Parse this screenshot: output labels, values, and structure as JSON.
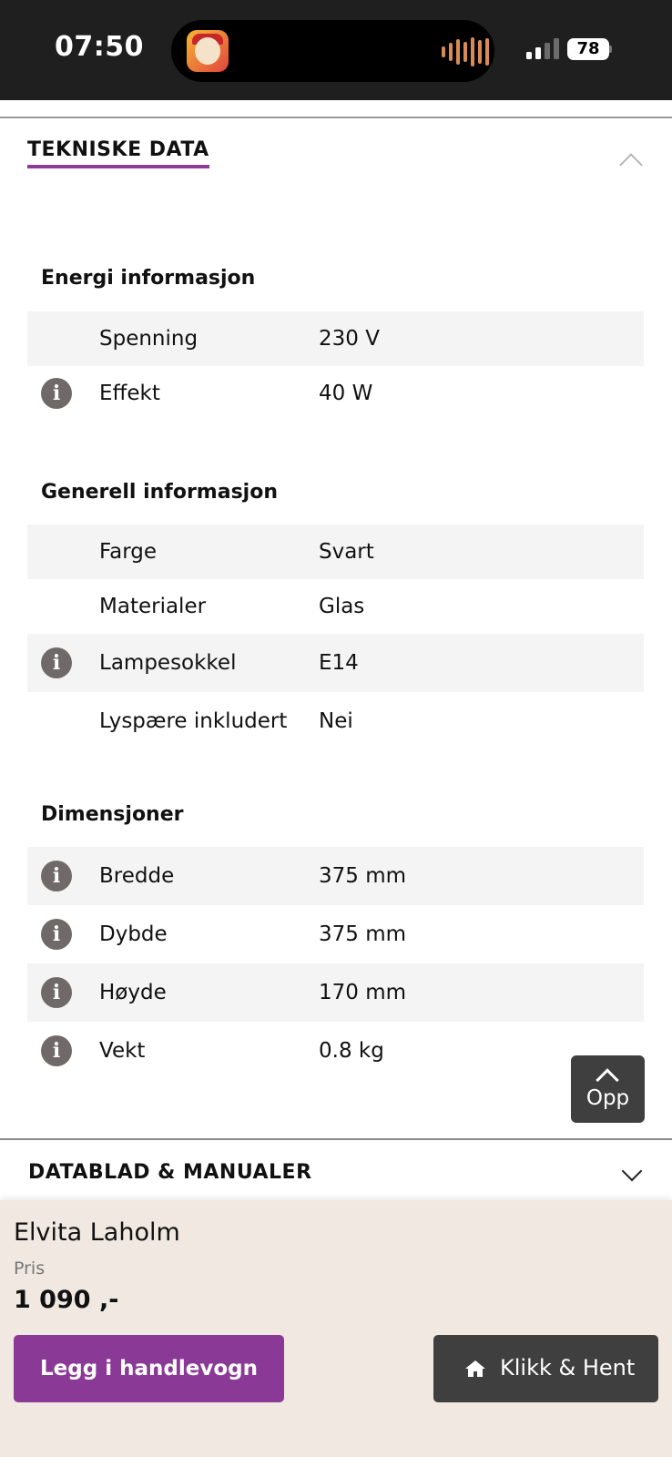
{
  "status_bar": {
    "time": "07:50",
    "battery": "78"
  },
  "section": {
    "title": "TEKNISKE DATA"
  },
  "groups": [
    {
      "title": "Energi informasjon",
      "rows": [
        {
          "label": "Spenning",
          "value": "230 V",
          "info": false
        },
        {
          "label": "Effekt",
          "value": "40 W",
          "info": true
        }
      ]
    },
    {
      "title": "Generell informasjon",
      "rows": [
        {
          "label": "Farge",
          "value": "Svart",
          "info": false
        },
        {
          "label": "Materialer",
          "value": "Glas",
          "info": false
        },
        {
          "label": "Lampesokkel",
          "value": "E14",
          "info": true
        },
        {
          "label": "Lyspære inkludert",
          "value": "Nei",
          "info": false
        }
      ]
    },
    {
      "title": "Dimensjoner",
      "rows": [
        {
          "label": "Bredde",
          "value": "375 mm",
          "info": true
        },
        {
          "label": "Dybde",
          "value": "375 mm",
          "info": true
        },
        {
          "label": "Høyde",
          "value": "170 mm",
          "info": true
        },
        {
          "label": "Vekt",
          "value": "0.8 kg",
          "info": true
        }
      ]
    }
  ],
  "info_glyph": "i",
  "scroll_top": {
    "label": "Opp"
  },
  "datablad": {
    "title": "DATABLAD & MANUALER"
  },
  "product": {
    "name": "Elvita Laholm",
    "price_label": "Pris",
    "price": "1 090 ,-",
    "cart_label": "Legg i handlevogn",
    "pickup_label": "Klikk & Hent"
  },
  "colors": {
    "accent": "#8a3a96",
    "dark_button": "#3f3f3f",
    "panel_bg": "#f0e8e1",
    "row_alt": "#f4f4f4"
  },
  "icons": {
    "info": "info-icon",
    "collapse": "chevron-up-icon",
    "expand": "chevron-down-icon",
    "scroll_top": "arrow-up-icon",
    "pickup": "home-icon"
  }
}
